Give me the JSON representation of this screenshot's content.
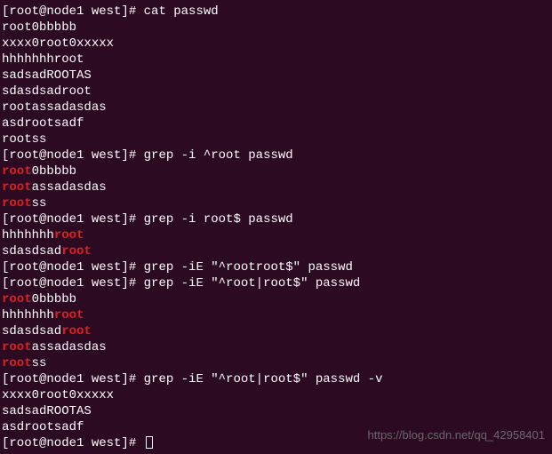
{
  "prompt": "[root@node1 west]# ",
  "commands": {
    "cat": "cat passwd",
    "grep1": "grep -i ^root passwd",
    "grep2": "grep -i root$ passwd",
    "grep3": "grep -iE \"^rootroot$\" passwd",
    "grep4": "grep -iE \"^root|root$\" passwd",
    "grep5": "grep -iE \"^root|root$\" passwd -v"
  },
  "cat_output": [
    "root0bbbbb",
    "xxxx0root0xxxxx",
    "hhhhhhhroot",
    "sadsadROOTAS",
    "sdasdsadroot",
    "rootassadasdas",
    "asdrootsadf",
    "rootss"
  ],
  "grep1_output": [
    {
      "match": "root",
      "rest": "0bbbbb"
    },
    {
      "match": "root",
      "rest": "assadasdas"
    },
    {
      "match": "root",
      "rest": "ss"
    }
  ],
  "grep2_output": [
    {
      "pre": "hhhhhhh",
      "match": "root"
    },
    {
      "pre": "sdasdsad",
      "match": "root"
    }
  ],
  "grep4_output": [
    {
      "pre": "",
      "match": "root",
      "post": "0bbbbb"
    },
    {
      "pre": "hhhhhhh",
      "match": "root",
      "post": ""
    },
    {
      "pre": "sdasdsad",
      "match": "root",
      "post": ""
    },
    {
      "pre": "",
      "match": "root",
      "post": "assadasdas"
    },
    {
      "pre": "",
      "match": "root",
      "post": "ss"
    }
  ],
  "grep5_output": [
    "xxxx0root0xxxxx",
    "sadsadROOTAS",
    "asdrootsadf"
  ],
  "watermark": "https://blog.csdn.net/qq_42958401"
}
